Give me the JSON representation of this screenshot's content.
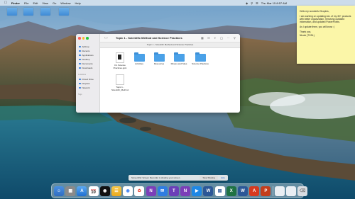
{
  "menubar": {
    "app_name": "Finder",
    "items": [
      "File",
      "Edit",
      "View",
      "Go",
      "Window",
      "Help"
    ],
    "clock": "Thu Mar 15  8:57 AM"
  },
  "sticky": {
    "lines": [
      "Hello my wonderful Scopies,",
      "I am working on updating ALL of my 30+ products with better organization, removing outdated information, and updated PowerPoints.",
      "As I update them, you will know :)",
      "Thank you,",
      "Nicole (TOSL)"
    ]
  },
  "finder": {
    "title": "Topic 1 - Scientific Method and Science Practices",
    "tab_label": "Topic 1 - Scientific Method and Science Practices",
    "sidebar": {
      "favorites": [
        "AirDrop",
        "Recents",
        "Applications",
        "Desktop",
        "Documents",
        "Downloads"
      ],
      "locations_header": "Locations",
      "locations": [
        "iCloud Drive",
        "Dropbox"
      ],
      "tags_header": "Tags",
      "locations2": [
        "Network"
      ]
    },
    "items": [
      {
        "name": "0.1 Science Practices.pptx",
        "kind": "doc"
      },
      {
        "name": "Activities",
        "kind": "folder"
      },
      {
        "name": "Resources",
        "kind": "folder"
      },
      {
        "name": "Movies and Sites",
        "kind": "folder"
      },
      {
        "name": "Science Practices",
        "kind": "folder"
      },
      {
        "name": "Topic 1 - Scientific_Meth.txt",
        "kind": "doc"
      }
    ]
  },
  "notification": {
    "message": "ScreenPal: Screen Recorder is sharing your screen.",
    "stop_label": "Stop Sharing",
    "hide_label": "Hide"
  },
  "dock": {
    "calendar_day": "10",
    "calendar_month": "MAR"
  },
  "colors": {
    "folder": "#4aa1e8",
    "sticky": "#fbf6a8",
    "sidebar_accent": "#2f7de1"
  }
}
